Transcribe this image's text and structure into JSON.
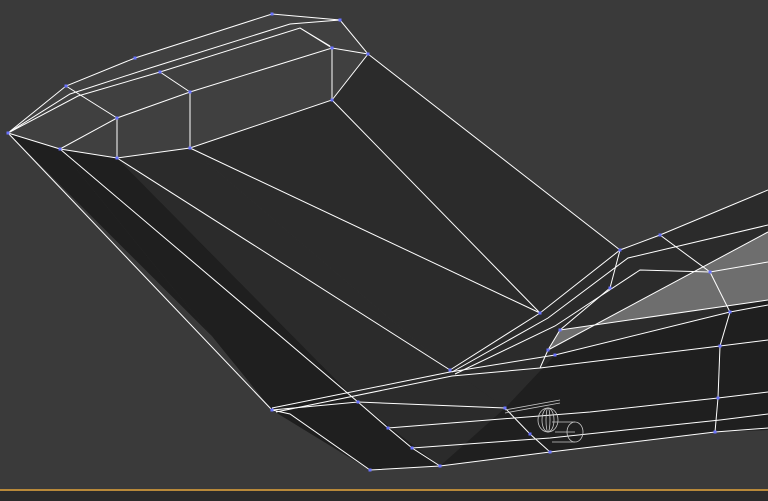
{
  "viewport": {
    "background_color": "#3a3a3a",
    "border_color": "#b8893a",
    "footer_color": "#2b2b2b"
  },
  "model": {
    "face_dark": "#1f1f1f",
    "face_mid": "#2b2b2b",
    "face_light": "#404040",
    "face_highlight": "#6e6e6e",
    "wire_color": "#ffffff",
    "vertex_color": "#6a73ff"
  },
  "gizmo": {
    "icon": "bone-gizmo-icon",
    "wire_color": "#c8c8c8"
  }
}
